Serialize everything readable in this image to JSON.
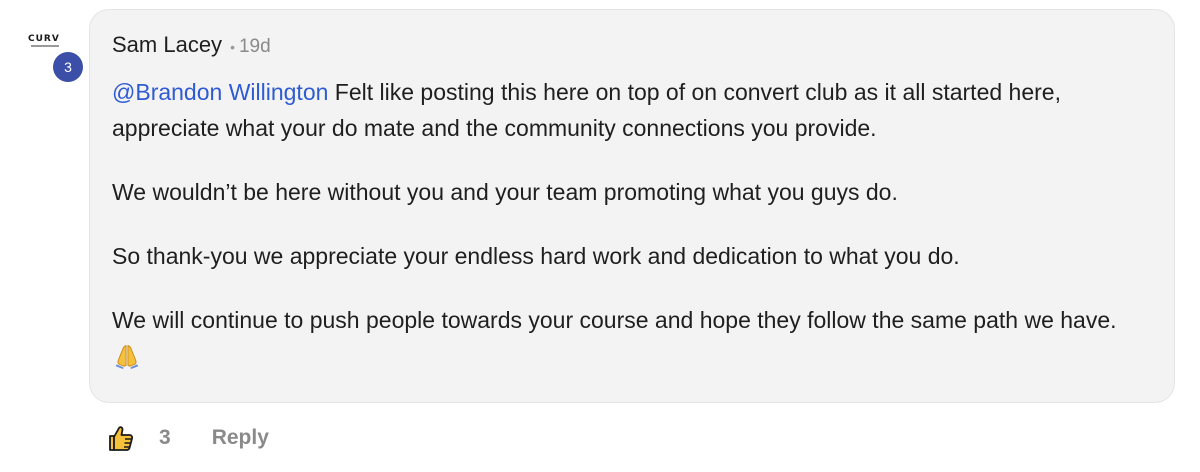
{
  "avatar": {
    "logo_text": "CURV",
    "level": "3"
  },
  "comment": {
    "author": "Sam Lacey",
    "separator": "•",
    "timestamp": "19d",
    "mention": "@Brandon Willington",
    "paragraph_1_rest": " Felt like posting this here on top of on convert club as it all started here, appreciate what your do mate and the community connections you provide.",
    "paragraph_2": "We wouldn’t be here without you and your team promoting what you guys do.",
    "paragraph_3": "So thank-you we appreciate your endless hard work and dedication to what you do.",
    "paragraph_4": "We will continue to push people towards your course and hope they follow the same path we have. ",
    "emoji_icon": "folded-hands-icon"
  },
  "actions": {
    "like_icon": "thumbs-up-icon",
    "like_count": "3",
    "reply_label": "Reply"
  },
  "colors": {
    "mention": "#2f5bd2",
    "badge": "#3b4fa8",
    "bubble": "#f3f3f3",
    "muted": "#8a8a8a"
  }
}
